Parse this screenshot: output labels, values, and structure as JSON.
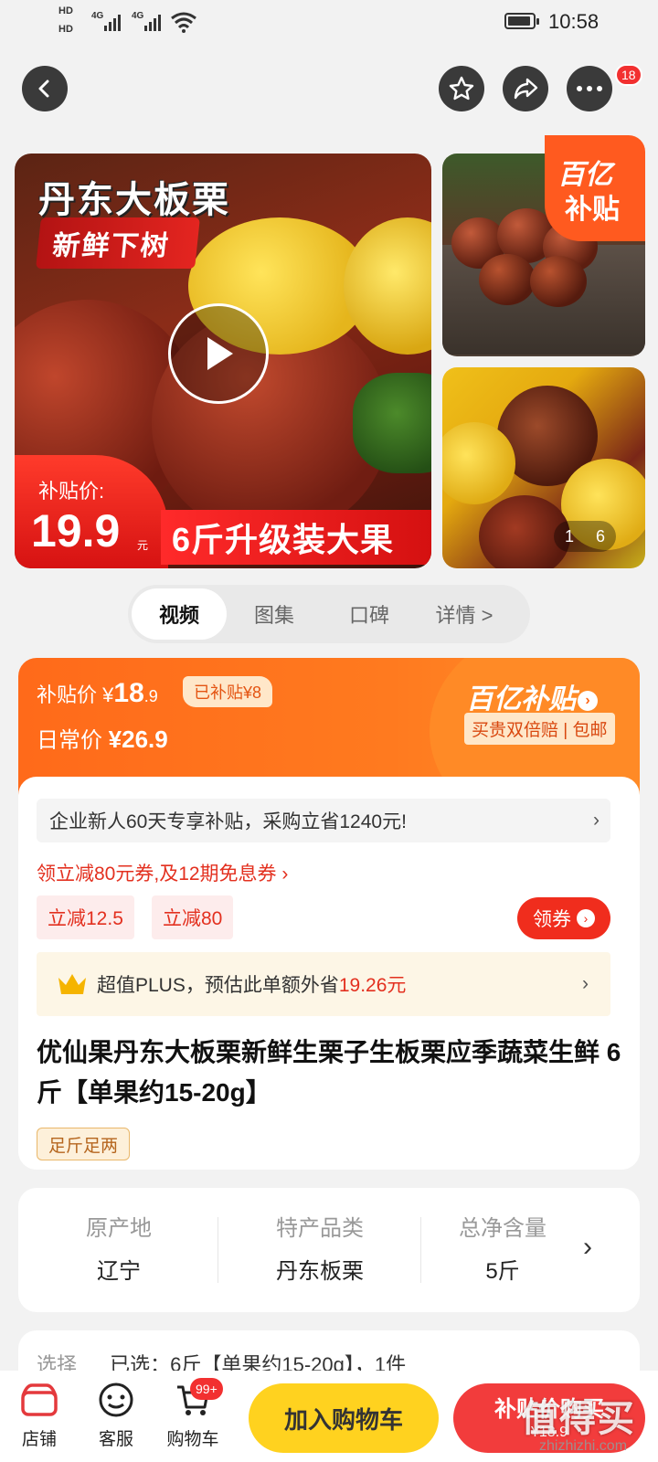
{
  "status_bar": {
    "time": "10:58",
    "hd1": "HD",
    "hd2": "HD",
    "net1": "4G",
    "net2": "4G"
  },
  "header": {
    "cart_badge": "18"
  },
  "gallery": {
    "title": "丹东大板栗",
    "subtitle": "新鲜下树",
    "price_label": "补贴价:",
    "price_value": "19.9",
    "price_unit": "元",
    "pack_text": "6斤升级装大果",
    "subsidy_l1": "百亿",
    "subsidy_l2": "补贴",
    "pager_current": "1",
    "pager_total": "6"
  },
  "media_tabs": [
    {
      "label": "视频"
    },
    {
      "label": "图集"
    },
    {
      "label": "口碑"
    },
    {
      "label": "详情 >"
    }
  ],
  "price": {
    "subsidy_label": "补贴价",
    "subsidy_symbol": "¥",
    "subsidy_int": "18",
    "subsidy_dec": ".9",
    "already_subsidy": "已补贴¥8",
    "daily_label": "日常价",
    "daily_value": "¥26.9",
    "brand": "百亿补贴",
    "guarantee": "买贵双倍赔 | 包邮"
  },
  "promo": {
    "new_user": "企业新人60天专享补贴，采购立省1240元!",
    "coupon_link": "领立减80元券,及12期免息券 ›",
    "chip1": "立减12.5",
    "chip2": "立减80",
    "get_coupon": "领券",
    "plus_prefix": "超值PLUS，预估此单额外省",
    "plus_amount": "19.26元"
  },
  "product": {
    "title": "优仙果丹东大板栗新鲜生栗子生板栗应季蔬菜生鲜 6斤【单果约15-20g】",
    "tag": "足斤足两"
  },
  "specs": [
    {
      "key": "原产地",
      "value": "辽宁"
    },
    {
      "key": "特产品类",
      "value": "丹东板栗"
    },
    {
      "key": "总净含量",
      "value": "5斤"
    }
  ],
  "choose": {
    "label": "选择",
    "value": "已选：6斤【单果约15-20g】，1件"
  },
  "bottom": {
    "shop": "店铺",
    "service": "客服",
    "cart": "购物车",
    "cart_count": "99+",
    "add_cart": "加入购物车",
    "buy": "补贴价购买",
    "buy_price": "¥18.9"
  },
  "watermark": {
    "main": "值得买",
    "sub": "zhizhizhi.com"
  }
}
